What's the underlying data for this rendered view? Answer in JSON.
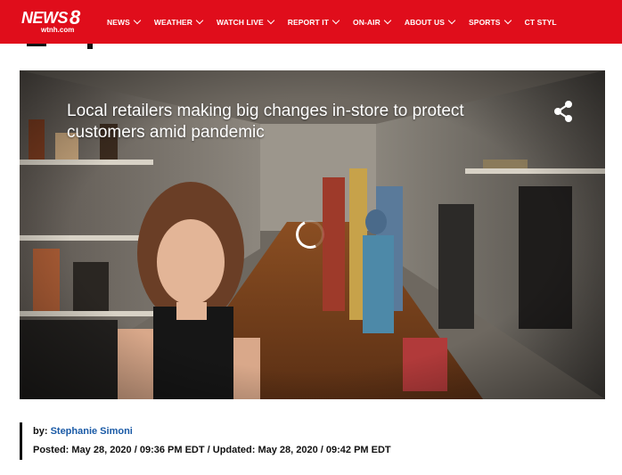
{
  "logo": {
    "word": "NEWS",
    "number": "8",
    "sub": "wtnh.com"
  },
  "nav": {
    "items": [
      {
        "label": "NEWS"
      },
      {
        "label": "WEATHER"
      },
      {
        "label": "WATCH LIVE"
      },
      {
        "label": "REPORT IT"
      },
      {
        "label": "ON-AIR"
      },
      {
        "label": "ABOUT US"
      },
      {
        "label": "SPORTS"
      },
      {
        "label": "CT STYL"
      }
    ]
  },
  "hero": {
    "title": "Local retailers making big changes in-store to protect customers amid pandemic",
    "share_icon": "share-icon"
  },
  "byline": {
    "by_prefix": "by:",
    "author": "Stephanie Simoni",
    "posted": "Posted: May 28, 2020 / 09:36 PM EDT / Updated: May 28, 2020 / 09:42 PM EDT"
  },
  "colors": {
    "brand_red": "#e00d1b",
    "author_link": "#1a5aa6"
  }
}
